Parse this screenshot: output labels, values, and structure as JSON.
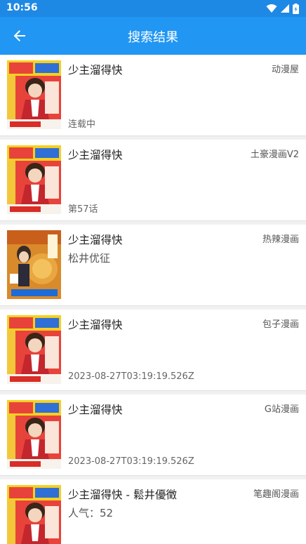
{
  "status_bar": {
    "time": "10:56"
  },
  "app_bar": {
    "title": "搜索结果"
  },
  "results": [
    {
      "name": "少主溜得快",
      "source": "动漫屋",
      "author": "",
      "update": "连载中",
      "cover": "red"
    },
    {
      "name": "少主溜得快",
      "source": "土豪漫画V2",
      "author": "",
      "update": "第57话",
      "cover": "red"
    },
    {
      "name": "少主溜得快",
      "source": "热辣漫画",
      "author": "松井优征",
      "update": "",
      "cover": "orange"
    },
    {
      "name": "少主溜得快",
      "source": "包子漫画",
      "author": "",
      "update": "2023-08-27T03:19:19.526Z",
      "cover": "red"
    },
    {
      "name": "少主溜得快",
      "source": "G站漫画",
      "author": "",
      "update": "2023-08-27T03:19:19.526Z",
      "cover": "red"
    },
    {
      "name": "少主溜得快 - 鬆井優徵",
      "source": "笔趣阁漫画",
      "author": "人气：52",
      "update": "",
      "cover": "red"
    }
  ]
}
